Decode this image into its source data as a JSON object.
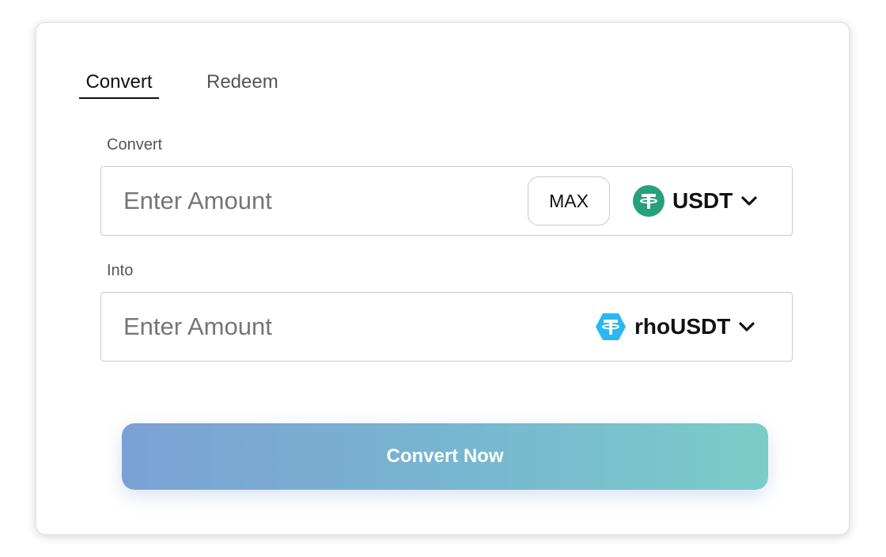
{
  "tabs": [
    {
      "label": "Convert",
      "active": true
    },
    {
      "label": "Redeem",
      "active": false
    }
  ],
  "convert_field": {
    "label": "Convert",
    "placeholder": "Enter Amount",
    "value": "",
    "max_label": "MAX",
    "token": {
      "symbol": "USDT",
      "icon": "tether-icon",
      "color": "#26a17b"
    }
  },
  "into_field": {
    "label": "Into",
    "placeholder": "Enter Amount",
    "value": "",
    "token": {
      "symbol": "rhoUSDT",
      "icon": "rho-tether-icon",
      "color": "#2bb8f2"
    }
  },
  "submit": {
    "label": "Convert Now",
    "gradient_start": "#7ba1d4",
    "gradient_end": "#7acdc8"
  }
}
